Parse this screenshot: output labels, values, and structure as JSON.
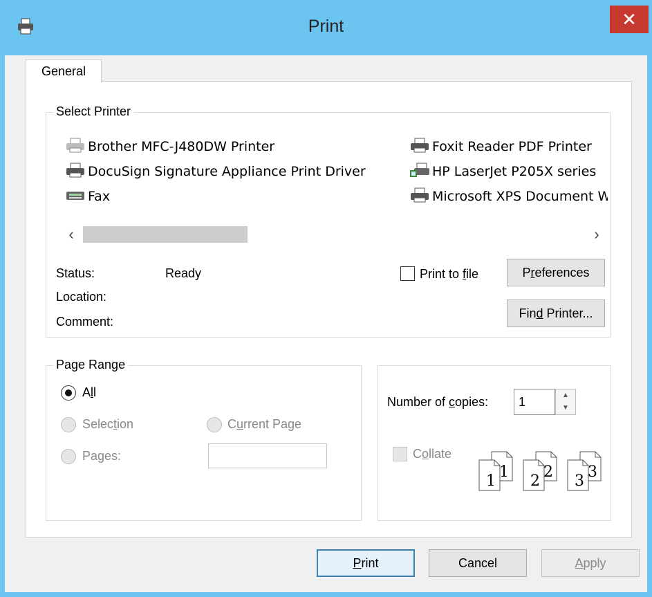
{
  "window": {
    "title": "Print",
    "close_label": "✕"
  },
  "tabs": [
    {
      "label": "General"
    }
  ],
  "select_printer": {
    "legend": "Select Printer",
    "printers_left": [
      {
        "name": "Brother MFC-J480DW Printer",
        "icon": "printer-icon"
      },
      {
        "name": "DocuSign Signature Appliance Print Driver",
        "icon": "printer-icon"
      },
      {
        "name": "Fax",
        "icon": "fax-icon"
      }
    ],
    "printers_right": [
      {
        "name": "Foxit Reader PDF Printer",
        "icon": "printer-icon"
      },
      {
        "name": "HP LaserJet P205X series",
        "icon": "network-printer-icon"
      },
      {
        "name": "Microsoft XPS Document Writer",
        "icon": "printer-icon"
      }
    ],
    "scroll_left": "‹",
    "scroll_right": "›",
    "status_label": "Status:",
    "status_value": "Ready",
    "location_label": "Location:",
    "comment_label": "Comment:",
    "print_to_file": {
      "pre": "Print to ",
      "accel": "f",
      "post": "ile",
      "checked": false
    },
    "preferences": {
      "pre": "P",
      "accel": "r",
      "post": "eferences"
    },
    "find_printer": {
      "pre": "Fin",
      "accel": "d",
      "post": " Printer..."
    }
  },
  "page_range": {
    "legend": "Page Range",
    "all": {
      "pre": "A",
      "accel": "l",
      "post": "l",
      "checked": true
    },
    "selection": {
      "pre": "Selec",
      "accel": "t",
      "post": "ion"
    },
    "current_page": {
      "pre": "C",
      "accel": "u",
      "post": "rrent Page"
    },
    "pages": {
      "pre": "Pa",
      "accel": "g",
      "post": "es:"
    }
  },
  "copies": {
    "label": {
      "pre": "Number of ",
      "accel": "c",
      "post": "opies:"
    },
    "value": "1",
    "spin_up": "▲",
    "spin_down": "▼",
    "collate": {
      "pre": "C",
      "accel": "o",
      "post": "llate",
      "checked": false
    },
    "collate_pages": [
      "1",
      "1",
      "2",
      "2",
      "3",
      "3"
    ]
  },
  "buttons": {
    "print": {
      "pre": "",
      "accel": "P",
      "post": "rint"
    },
    "cancel": "Cancel",
    "apply": {
      "pre": "",
      "accel": "A",
      "post": "pply"
    }
  }
}
